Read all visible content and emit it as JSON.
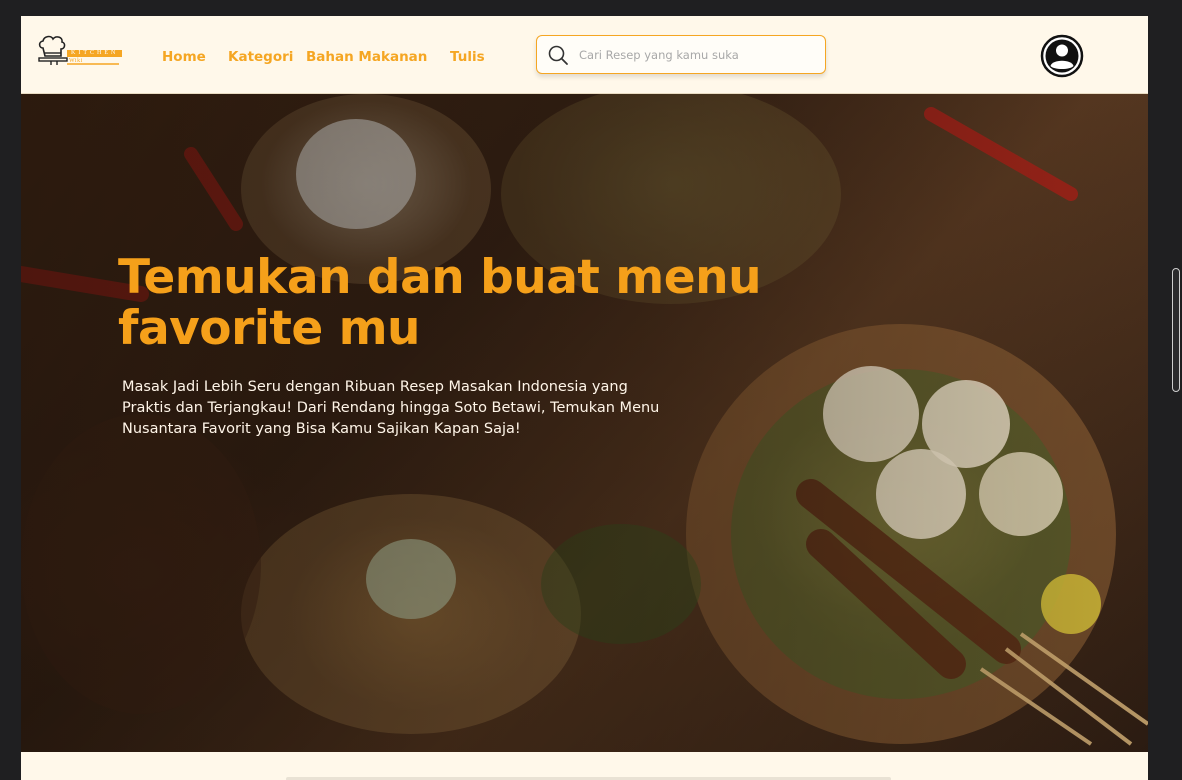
{
  "brand": {
    "logo_text": "KITCHEN",
    "logo_sub": "Wiki"
  },
  "nav": {
    "items": [
      {
        "label": "Home"
      },
      {
        "label": "Kategori"
      },
      {
        "label": "Bahan Makanan"
      },
      {
        "label": "Tulis"
      }
    ]
  },
  "search": {
    "placeholder": "Cari Resep yang kamu suka",
    "value": ""
  },
  "hero": {
    "title": "Temukan dan buat menu favorite mu",
    "description": "Masak Jadi Lebih Seru dengan Ribuan Resep Masakan Indonesia yang Praktis dan Terjangkau! Dari Rendang hingga Soto Betawi, Temukan Menu Nusantara Favorit yang Bisa Kamu Sajikan Kapan Saja!"
  },
  "colors": {
    "accent": "#f5a623",
    "navbar_bg": "#fff8ea",
    "hero_title": "#f5a01a",
    "hero_text": "#fff5e8"
  },
  "icons": {
    "search": "search-icon",
    "profile": "user-circle-icon",
    "logo": "chef-hat-icon"
  }
}
